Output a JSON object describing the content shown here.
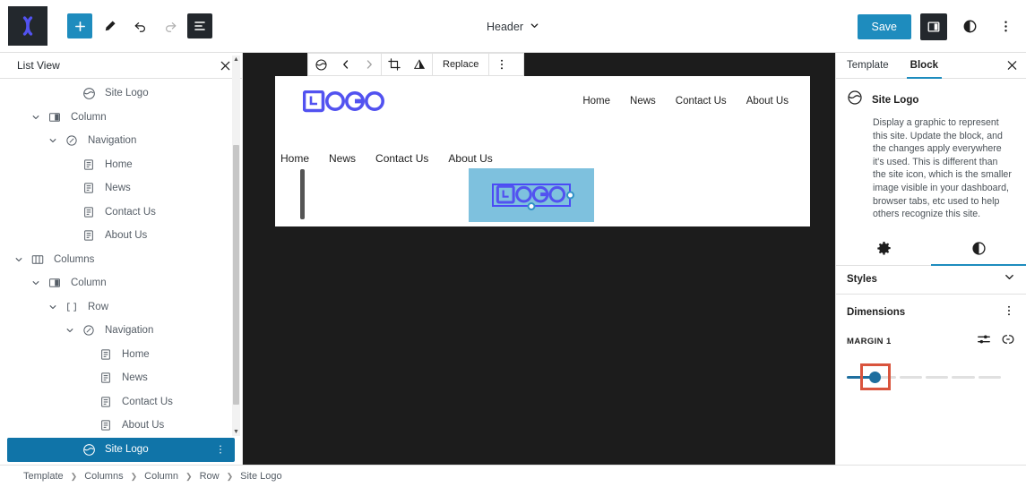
{
  "topbar": {
    "logo_icon": "wordpress-x-logo-icon",
    "tools": [
      {
        "name": "add-block-button",
        "icon": "plus-icon",
        "style": "primary"
      },
      {
        "name": "edit-tool-button",
        "icon": "pencil-icon",
        "style": "plain"
      },
      {
        "name": "undo-button",
        "icon": "undo-arrow-icon",
        "style": "plain"
      },
      {
        "name": "redo-button",
        "icon": "redo-arrow-icon",
        "style": "disabled"
      },
      {
        "name": "list-view-button",
        "icon": "list-view-icon",
        "style": "dark"
      }
    ],
    "document_label": "Header",
    "save_label": "Save",
    "settings_toggle_icon": "sidebar-panel-icon",
    "styles_icon": "contrast-circle-icon",
    "options_icon": "vertical-ellipsis-icon"
  },
  "list_view": {
    "title": "List View",
    "close_icon": "close-icon",
    "items": [
      {
        "label": "Site Logo",
        "icon": "site-logo-icon",
        "depth": 3,
        "caret": "",
        "selected": false
      },
      {
        "label": "Column",
        "icon": "column-icon",
        "depth": 1,
        "caret": "down",
        "selected": false
      },
      {
        "label": "Navigation",
        "icon": "navigation-icon",
        "depth": 2,
        "caret": "down",
        "selected": false
      },
      {
        "label": "Home",
        "icon": "page-icon",
        "depth": 3,
        "caret": "",
        "selected": false
      },
      {
        "label": "News",
        "icon": "page-icon",
        "depth": 3,
        "caret": "",
        "selected": false
      },
      {
        "label": "Contact Us",
        "icon": "page-icon",
        "depth": 3,
        "caret": "",
        "selected": false
      },
      {
        "label": "About Us",
        "icon": "page-icon",
        "depth": 3,
        "caret": "",
        "selected": false
      },
      {
        "label": "Columns",
        "icon": "columns-icon",
        "depth": 0,
        "caret": "down",
        "selected": false
      },
      {
        "label": "Column",
        "icon": "column-icon",
        "depth": 1,
        "caret": "down",
        "selected": false
      },
      {
        "label": "Row",
        "icon": "row-icon",
        "depth": 2,
        "caret": "down",
        "selected": false
      },
      {
        "label": "Navigation",
        "icon": "navigation-icon",
        "depth": 3,
        "caret": "down",
        "selected": false
      },
      {
        "label": "Home",
        "icon": "page-icon",
        "depth": 4,
        "caret": "",
        "selected": false
      },
      {
        "label": "News",
        "icon": "page-icon",
        "depth": 4,
        "caret": "",
        "selected": false
      },
      {
        "label": "Contact Us",
        "icon": "page-icon",
        "depth": 4,
        "caret": "",
        "selected": false
      },
      {
        "label": "About Us",
        "icon": "page-icon",
        "depth": 4,
        "caret": "",
        "selected": false
      },
      {
        "label": "Site Logo",
        "icon": "site-logo-icon",
        "depth": 3,
        "caret": "",
        "selected": true
      }
    ]
  },
  "canvas": {
    "block_toolbar": {
      "block_icon": "site-logo-icon",
      "move_left_icon": "chevron-left-icon",
      "move_right_icon": "chevron-right-icon",
      "crop_icon": "crop-icon",
      "duotone_icon": "duotone-triangle-icon",
      "replace_label": "Replace",
      "more_icon": "vertical-ellipsis-icon"
    },
    "site_logo_text": "LOGO",
    "logo_color": "#5252f0",
    "selected_block_bg": "#7ec1de",
    "primary_nav": [
      "Home",
      "News",
      "Contact Us",
      "About Us"
    ],
    "secondary_nav": [
      "Home",
      "News",
      "Contact Us",
      "About Us"
    ]
  },
  "sidebar": {
    "tabs": [
      {
        "label": "Template",
        "active": false
      },
      {
        "label": "Block",
        "active": true
      }
    ],
    "close_icon": "close-icon",
    "block": {
      "icon": "site-logo-icon",
      "title": "Site Logo",
      "description": "Display a graphic to represent this site. Update the block, and the changes apply everywhere it's used. This is different than the site icon, which is the smaller image visible in your dashboard, browser tabs, etc used to help others recognize this site."
    },
    "subtabs": [
      {
        "name": "settings",
        "icon": "gear-icon",
        "active": false
      },
      {
        "name": "styles",
        "icon": "contrast-circle-icon",
        "active": true
      }
    ],
    "styles_panel": {
      "title": "Styles",
      "chevron_icon": "chevron-down-icon"
    },
    "dimensions_panel": {
      "title": "Dimensions",
      "more_icon": "vertical-ellipsis-icon",
      "margin_label": "MARGIN",
      "margin_value": "1",
      "sides_icon": "sides-settings-icon",
      "link_icon": "link-sides-icon",
      "slider_segments": 6,
      "slider_position": 1
    }
  },
  "breadcrumb": {
    "items": [
      "Template",
      "Columns",
      "Column",
      "Row",
      "Site Logo"
    ],
    "separator": "❯"
  }
}
